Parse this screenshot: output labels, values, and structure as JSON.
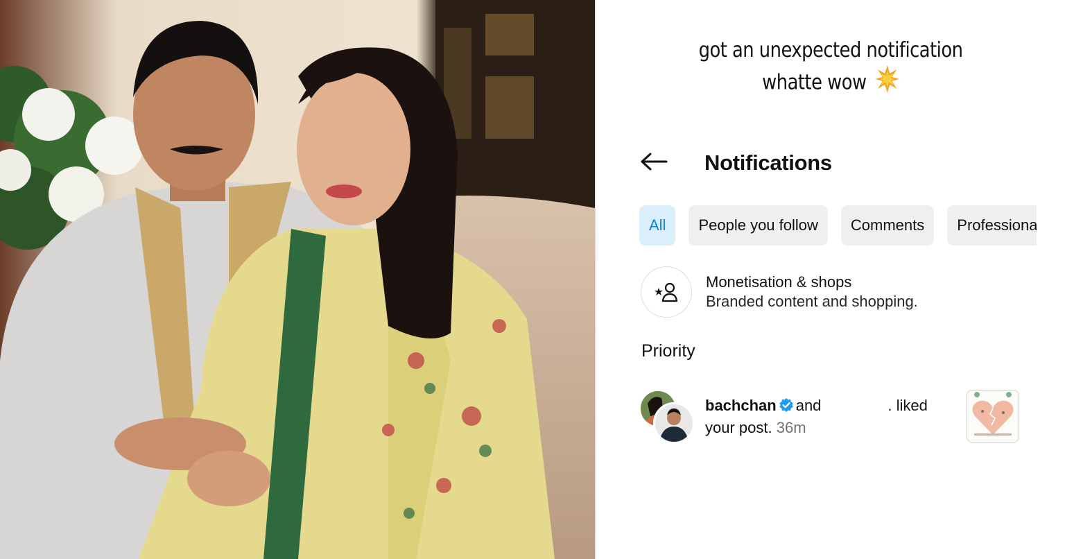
{
  "caption": {
    "line1": "got an unexpected notification",
    "line2": "whatte wow"
  },
  "header": {
    "back_icon": "arrow-left-icon",
    "title": "Notifications"
  },
  "filters": {
    "items": [
      {
        "label": "All",
        "active": true
      },
      {
        "label": "People you follow",
        "active": false
      },
      {
        "label": "Comments",
        "active": false
      },
      {
        "label": "Professional",
        "active": false
      }
    ]
  },
  "monetisation": {
    "icon": "star-person-icon",
    "title": "Monetisation & shops",
    "subtitle": "Branded content and shopping."
  },
  "section": {
    "title": "Priority"
  },
  "notification": {
    "username": "bachchan",
    "connector": "and",
    "action": ". liked",
    "line2": "your post.",
    "time": "36m"
  },
  "colors": {
    "accent_blue": "#0a84d6",
    "chip_active_bg": "#dbeefb",
    "chip_bg": "#efefef",
    "verified_blue": "#1d9bf0"
  }
}
